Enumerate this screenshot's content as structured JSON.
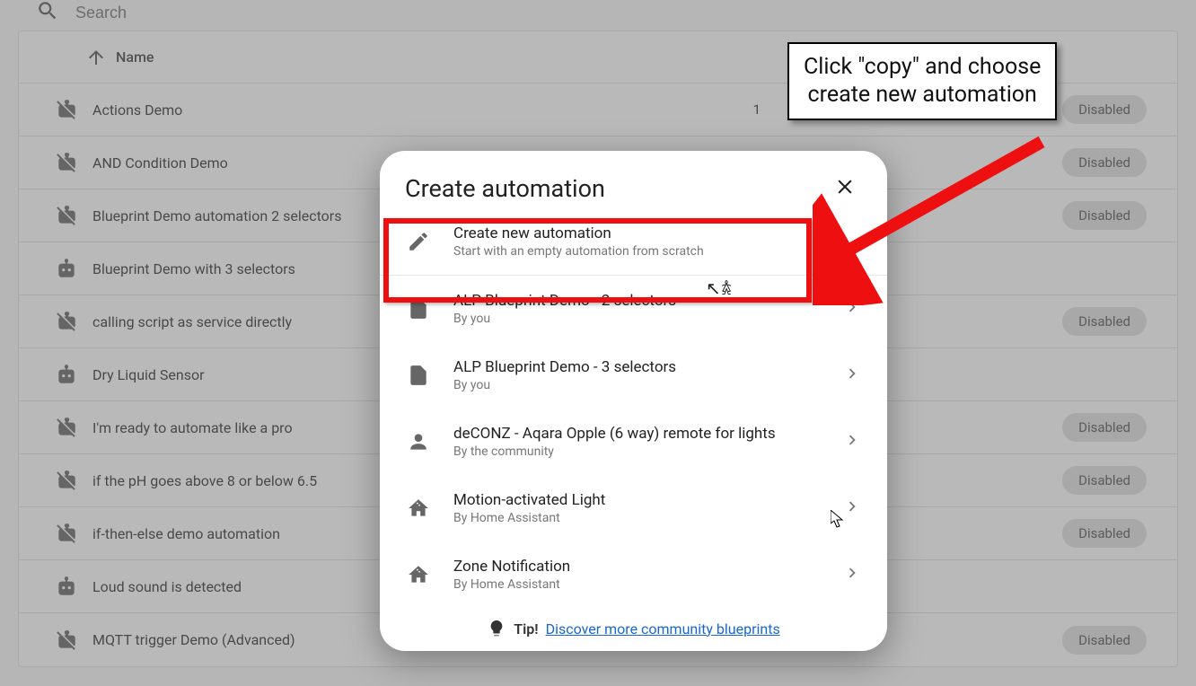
{
  "search": {
    "placeholder": "Search"
  },
  "columns": {
    "name": "Name"
  },
  "rows": [
    {
      "name": "Actions Demo",
      "icon": "robot-off",
      "count": "1",
      "chip": "Disabled"
    },
    {
      "name": "AND Condition Demo",
      "icon": "robot-off",
      "chip": "Disabled"
    },
    {
      "name": "Blueprint Demo automation 2 selectors",
      "icon": "robot-off",
      "chip": "Disabled"
    },
    {
      "name": "Blueprint Demo with 3 selectors",
      "icon": "robot",
      "chip": ""
    },
    {
      "name": "calling script as service directly",
      "icon": "robot-off",
      "chip": "Disabled"
    },
    {
      "name": "Dry Liquid Sensor",
      "icon": "robot",
      "chip": ""
    },
    {
      "name": "I'm ready to automate like a pro",
      "icon": "robot-off",
      "chip": "Disabled"
    },
    {
      "name": "if the pH goes above 8 or below 6.5",
      "icon": "robot-off",
      "chip": "Disabled"
    },
    {
      "name": "if-then-else demo automation",
      "icon": "robot-off",
      "chip": "Disabled"
    },
    {
      "name": "Loud sound is detected",
      "icon": "robot",
      "chip": ""
    },
    {
      "name": "MQTT trigger Demo (Advanced)",
      "icon": "robot-off",
      "chip": "Disabled"
    }
  ],
  "dialog": {
    "title": "Create automation",
    "options": [
      {
        "icon": "pencil",
        "title": "Create new automation",
        "sub": "Start with an empty automation from scratch",
        "chev": false,
        "border": true
      },
      {
        "icon": "file",
        "title": "ALP Blueprint Demo - 2 selectors",
        "sub": "By you",
        "chev": true
      },
      {
        "icon": "file",
        "title": "ALP Blueprint Demo - 3 selectors",
        "sub": "By you",
        "chev": true
      },
      {
        "icon": "person",
        "title": "deCONZ - Aqara Opple (6 way) remote for lights",
        "sub": "By the community",
        "chev": true
      },
      {
        "icon": "home",
        "title": "Motion-activated Light",
        "sub": "By Home Assistant",
        "chev": true
      },
      {
        "icon": "home",
        "title": "Zone Notification",
        "sub": "By Home Assistant",
        "chev": true
      }
    ],
    "tip_label": "Tip!",
    "tip_link": "Discover more community blueprints"
  },
  "callout": {
    "line1": "Click \"copy\" and choose",
    "line2": "create new automation"
  }
}
